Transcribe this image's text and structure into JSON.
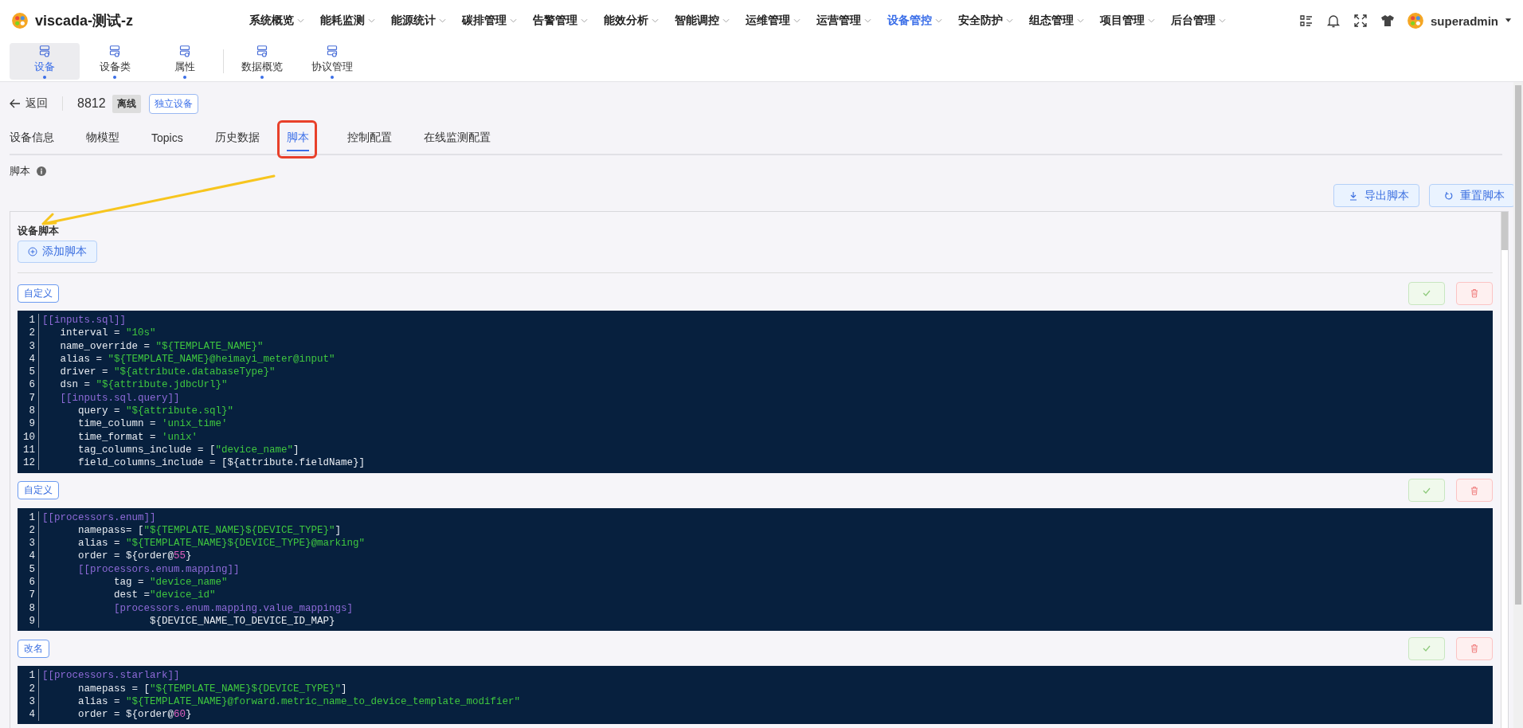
{
  "app": {
    "title": "viscada-测试-z"
  },
  "nav": [
    {
      "label": "系统概览",
      "selected": false
    },
    {
      "label": "能耗监测",
      "selected": false
    },
    {
      "label": "能源统计",
      "selected": false
    },
    {
      "label": "碳排管理",
      "selected": false
    },
    {
      "label": "告警管理",
      "selected": false
    },
    {
      "label": "能效分析",
      "selected": false
    },
    {
      "label": "智能调控",
      "selected": false
    },
    {
      "label": "运维管理",
      "selected": false
    },
    {
      "label": "运营管理",
      "selected": false
    },
    {
      "label": "设备管控",
      "selected": true
    },
    {
      "label": "安全防护",
      "selected": false
    },
    {
      "label": "组态管理",
      "selected": false
    },
    {
      "label": "项目管理",
      "selected": false
    },
    {
      "label": "后台管理",
      "selected": false
    }
  ],
  "user": {
    "name": "superadmin"
  },
  "toolbar": [
    {
      "label": "设备",
      "selected": true,
      "divider_before": false
    },
    {
      "label": "设备类",
      "selected": false,
      "divider_before": false
    },
    {
      "label": "属性",
      "selected": false,
      "divider_before": false
    },
    {
      "label": "数据概览",
      "selected": false,
      "divider_before": true
    },
    {
      "label": "协议管理",
      "selected": false,
      "divider_before": false
    }
  ],
  "device": {
    "back": "返回",
    "id": "8812",
    "status": "离线",
    "type": "独立设备"
  },
  "tabs": [
    {
      "label": "设备信息",
      "selected": false,
      "highlighted": false
    },
    {
      "label": "物模型",
      "selected": false,
      "highlighted": false
    },
    {
      "label": "Topics",
      "selected": false,
      "highlighted": false
    },
    {
      "label": "历史数据",
      "selected": false,
      "highlighted": false
    },
    {
      "label": "脚本",
      "selected": true,
      "highlighted": true
    },
    {
      "label": "控制配置",
      "selected": false,
      "highlighted": false
    },
    {
      "label": "在线监测配置",
      "selected": false,
      "highlighted": false
    }
  ],
  "section": {
    "title": "脚本"
  },
  "actions": [
    {
      "label": "导出脚本",
      "kind": "export"
    },
    {
      "label": "重置脚本",
      "kind": "reset"
    }
  ],
  "card": {
    "title": "设备脚本",
    "add_button": "添加脚本"
  },
  "scripts": [
    {
      "tag": "自定义",
      "lines": [
        {
          "n": "1",
          "tokens": [
            {
              "t": "[[inputs.sql]]",
              "kind": "section"
            }
          ]
        },
        {
          "n": "2",
          "tokens": [
            {
              "t": "   interval = ",
              "kind": "plain"
            },
            {
              "t": "\"10s\"",
              "kind": "string"
            }
          ]
        },
        {
          "n": "3",
          "tokens": [
            {
              "t": "   name_override = ",
              "kind": "plain"
            },
            {
              "t": "\"${TEMPLATE_NAME}\"",
              "kind": "string"
            }
          ]
        },
        {
          "n": "4",
          "tokens": [
            {
              "t": "   alias = ",
              "kind": "plain"
            },
            {
              "t": "\"${TEMPLATE_NAME}@heimayi_meter@input\"",
              "kind": "string"
            }
          ]
        },
        {
          "n": "5",
          "tokens": [
            {
              "t": "   driver = ",
              "kind": "plain"
            },
            {
              "t": "\"${attribute.databaseType}\"",
              "kind": "string"
            }
          ]
        },
        {
          "n": "6",
          "tokens": [
            {
              "t": "   dsn = ",
              "kind": "plain"
            },
            {
              "t": "\"${attribute.jdbcUrl}\"",
              "kind": "string"
            }
          ]
        },
        {
          "n": "7",
          "tokens": [
            {
              "t": "   [[inputs.sql.query]]",
              "kind": "section"
            }
          ]
        },
        {
          "n": "8",
          "tokens": [
            {
              "t": "      query = ",
              "kind": "plain"
            },
            {
              "t": "\"${attribute.sql}\"",
              "kind": "string"
            }
          ]
        },
        {
          "n": "9",
          "tokens": [
            {
              "t": "      time_column = ",
              "kind": "plain"
            },
            {
              "t": "'unix_time'",
              "kind": "string"
            }
          ]
        },
        {
          "n": "10",
          "tokens": [
            {
              "t": "      time_format = ",
              "kind": "plain"
            },
            {
              "t": "'unix'",
              "kind": "string"
            }
          ]
        },
        {
          "n": "11",
          "tokens": [
            {
              "t": "      tag_columns_include = [",
              "kind": "plain"
            },
            {
              "t": "\"device_name\"",
              "kind": "string"
            },
            {
              "t": "]",
              "kind": "plain"
            }
          ]
        },
        {
          "n": "12",
          "tokens": [
            {
              "t": "      field_columns_include = [${attribute.fieldName}]",
              "kind": "plain"
            }
          ]
        }
      ]
    },
    {
      "tag": "自定义",
      "lines": [
        {
          "n": "1",
          "tokens": [
            {
              "t": "[[processors.enum]]",
              "kind": "section"
            }
          ]
        },
        {
          "n": "2",
          "tokens": [
            {
              "t": "      namepass= [",
              "kind": "plain"
            },
            {
              "t": "\"${TEMPLATE_NAME}${DEVICE_TYPE}\"",
              "kind": "string"
            },
            {
              "t": "]",
              "kind": "plain"
            }
          ]
        },
        {
          "n": "3",
          "tokens": [
            {
              "t": "      alias = ",
              "kind": "plain"
            },
            {
              "t": "\"${TEMPLATE_NAME}${DEVICE_TYPE}@marking\"",
              "kind": "string"
            }
          ]
        },
        {
          "n": "4",
          "tokens": [
            {
              "t": "      order = ${order@",
              "kind": "plain"
            },
            {
              "t": "55",
              "kind": "number"
            },
            {
              "t": "}",
              "kind": "plain"
            }
          ]
        },
        {
          "n": "5",
          "tokens": [
            {
              "t": "      [[processors.enum.mapping]]",
              "kind": "section"
            }
          ]
        },
        {
          "n": "6",
          "tokens": [
            {
              "t": "            tag = ",
              "kind": "plain"
            },
            {
              "t": "\"device_name\"",
              "kind": "string"
            }
          ]
        },
        {
          "n": "7",
          "tokens": [
            {
              "t": "            dest =",
              "kind": "plain"
            },
            {
              "t": "\"device_id\"",
              "kind": "string"
            }
          ]
        },
        {
          "n": "8",
          "tokens": [
            {
              "t": "            [processors.enum.mapping.value_mappings]",
              "kind": "section"
            }
          ]
        },
        {
          "n": "9",
          "tokens": [
            {
              "t": "                  ${DEVICE_NAME_TO_DEVICE_ID_MAP}",
              "kind": "plain"
            }
          ]
        }
      ]
    },
    {
      "tag": "改名",
      "lines": [
        {
          "n": "1",
          "tokens": [
            {
              "t": "[[processors.starlark]]",
              "kind": "section"
            }
          ]
        },
        {
          "n": "2",
          "tokens": [
            {
              "t": "      namepass = [",
              "kind": "plain"
            },
            {
              "t": "\"${TEMPLATE_NAME}${DEVICE_TYPE}\"",
              "kind": "string"
            },
            {
              "t": "]",
              "kind": "plain"
            }
          ]
        },
        {
          "n": "3",
          "tokens": [
            {
              "t": "      alias = ",
              "kind": "plain"
            },
            {
              "t": "\"${TEMPLATE_NAME}@forward.metric_name_to_device_template_modifier\"",
              "kind": "string"
            }
          ]
        },
        {
          "n": "4",
          "tokens": [
            {
              "t": "      order = ${order@",
              "kind": "plain"
            },
            {
              "t": "60",
              "kind": "number"
            },
            {
              "t": "}",
              "kind": "plain"
            }
          ]
        }
      ]
    }
  ]
}
